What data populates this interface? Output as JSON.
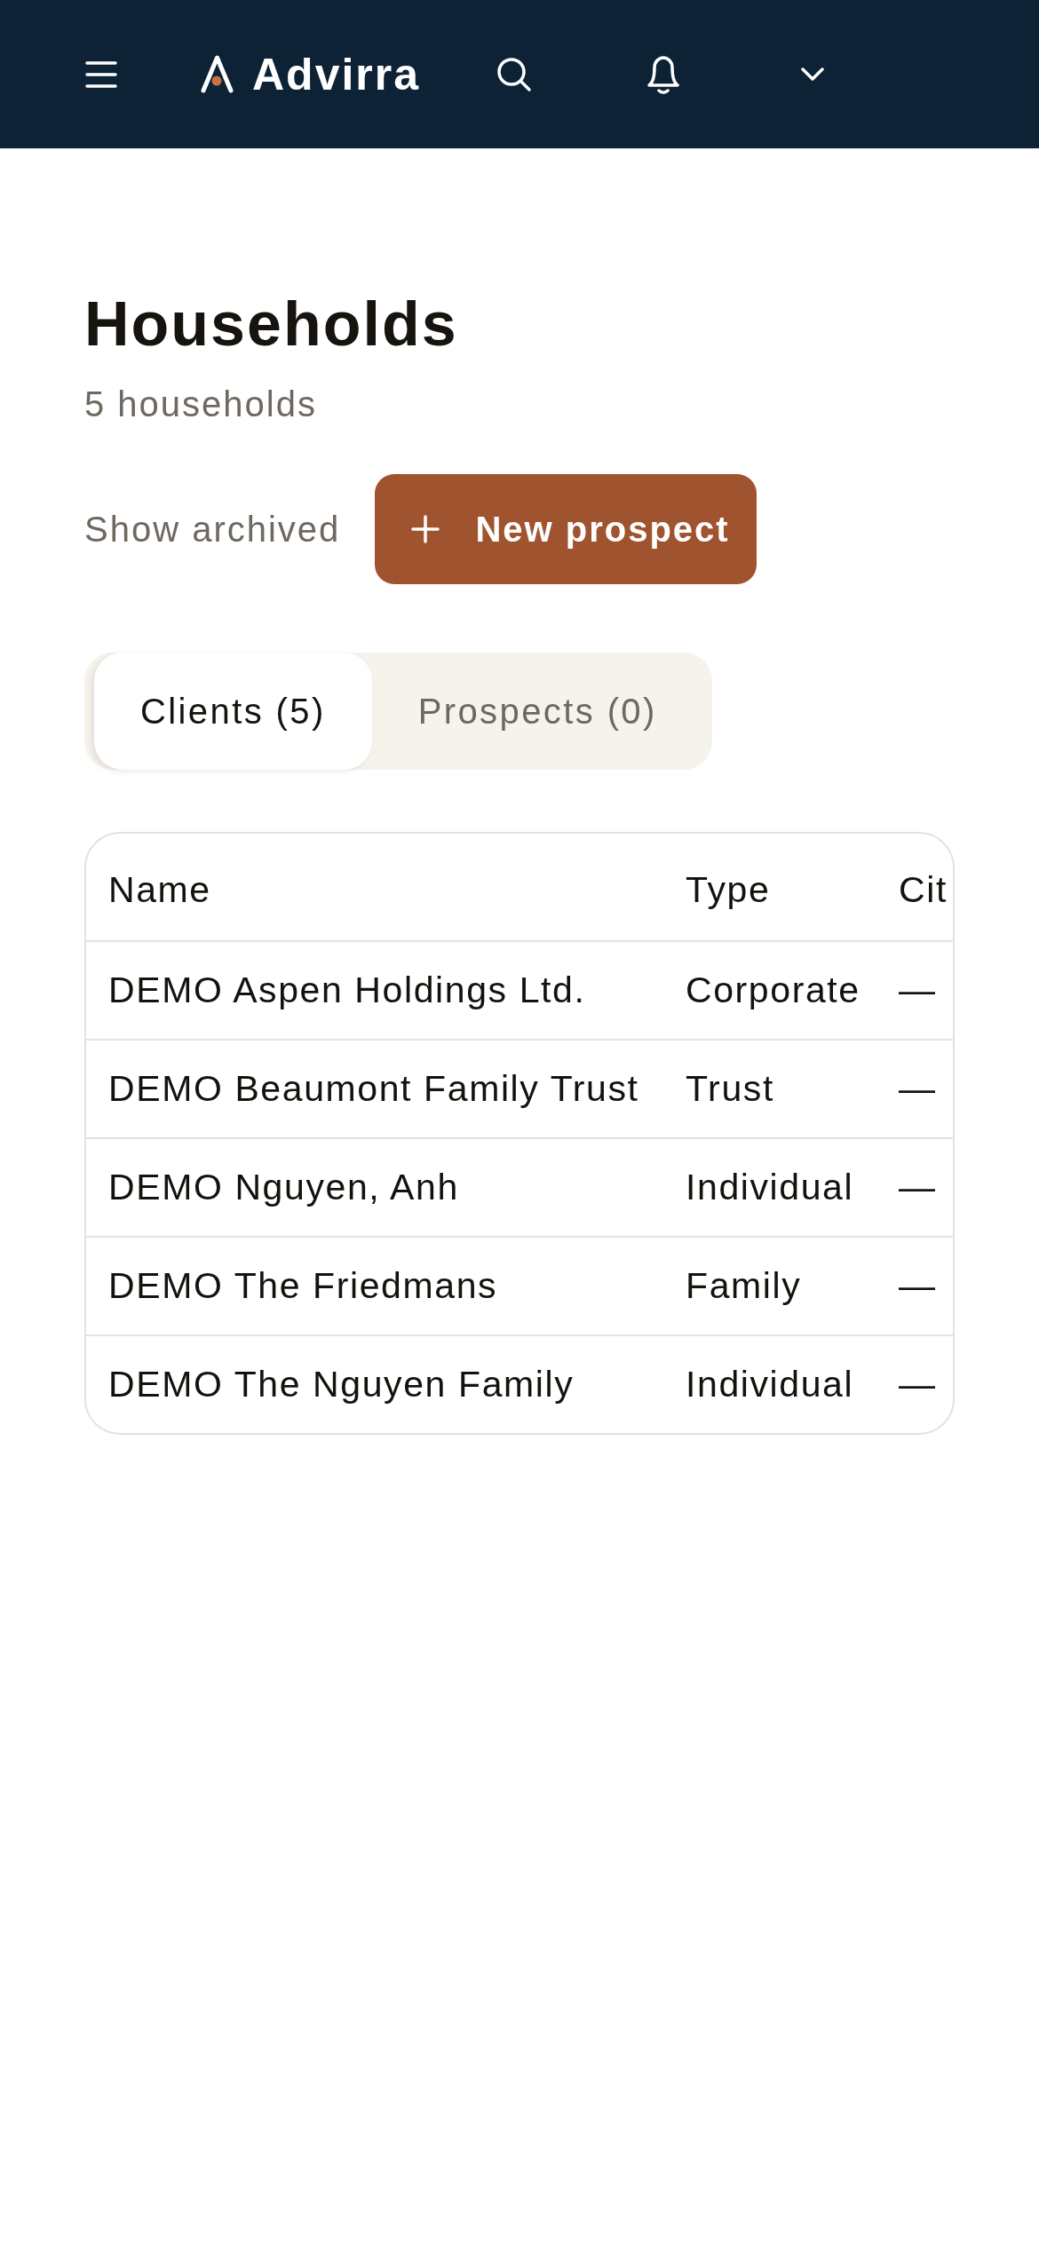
{
  "header": {
    "brand": "Advirra"
  },
  "page": {
    "title": "Households",
    "subtitle": "5 households"
  },
  "actions": {
    "show_archived": "Show archived",
    "new_button": "New prospect"
  },
  "tabs": [
    {
      "label": "Clients (5)",
      "selected": true
    },
    {
      "label": "Prospects (0)",
      "selected": false
    }
  ],
  "table": {
    "columns": [
      "Name",
      "Type",
      "Cit"
    ],
    "rows": [
      [
        "DEMO Aspen Holdings Ltd.",
        "Corporate",
        "—"
      ],
      [
        "DEMO Beaumont Family Trust",
        "Trust",
        "—"
      ],
      [
        "DEMO Nguyen, Anh",
        "Individual",
        "—"
      ],
      [
        "DEMO The Friedmans",
        "Family",
        "—"
      ],
      [
        "DEMO The Nguyen Family",
        "Individual",
        "—"
      ]
    ]
  }
}
